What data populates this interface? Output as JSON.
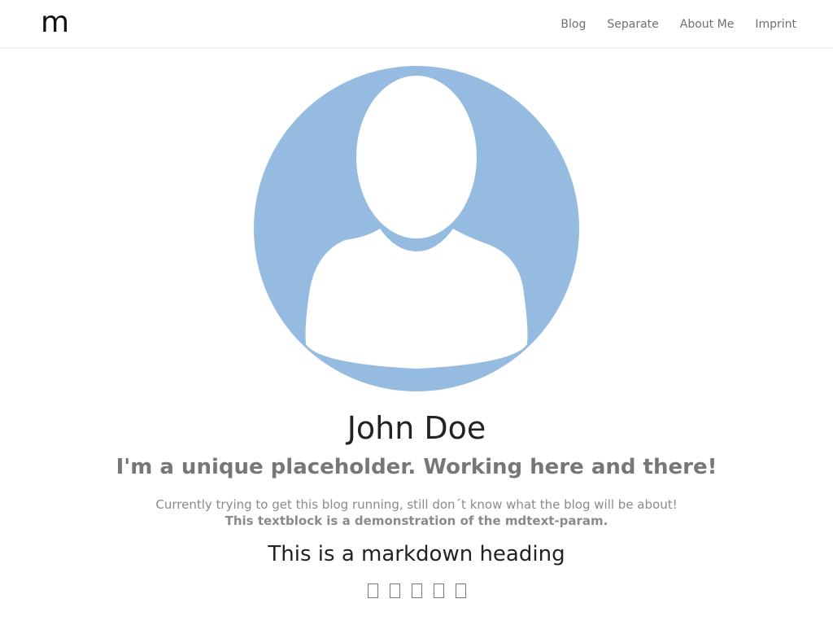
{
  "navbar": {
    "brand": "m",
    "links": [
      "Blog",
      "Separate",
      "About Me",
      "Imprint"
    ]
  },
  "profile": {
    "name": "John Doe",
    "tagline": "I'm a unique placeholder. Working here and there!",
    "description": "Currently trying to get this blog running, still don´t know what the blog will be about!",
    "description_strong": "This textblock is a demonstration of the mdtext-param.",
    "markdown_heading": "This is a markdown heading"
  },
  "social": {
    "icons": [
      "social-icon-1",
      "social-icon-2",
      "social-icon-3",
      "social-icon-4",
      "social-icon-5"
    ]
  },
  "colors": {
    "avatar_bg": "#96BBE0",
    "avatar_fg": "#FFFFFF",
    "nav_text": "#707070",
    "name_text": "#222222",
    "tagline_text": "#777777",
    "desc_text": "#8A8A8A"
  }
}
